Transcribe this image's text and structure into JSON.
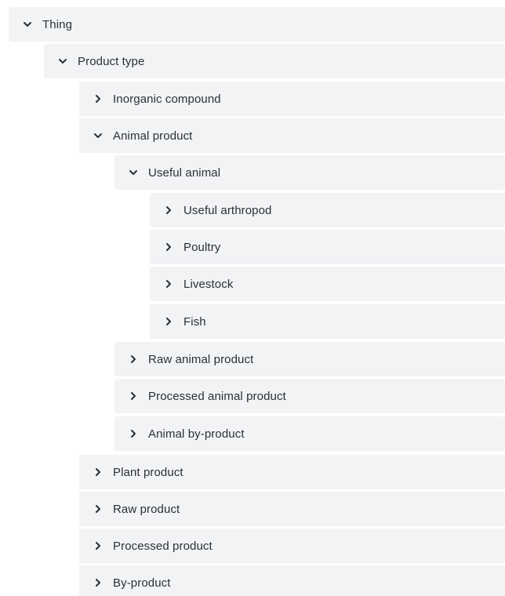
{
  "tree": {
    "nodes": [
      {
        "label": "Thing",
        "expanded": true,
        "icon": "chevron-down-icon"
      },
      {
        "label": "Product type",
        "expanded": true,
        "icon": "chevron-down-icon"
      },
      {
        "label": "Inorganic compound",
        "expanded": false,
        "icon": "chevron-right-icon"
      },
      {
        "label": "Animal product",
        "expanded": true,
        "icon": "chevron-down-icon"
      },
      {
        "label": "Useful animal",
        "expanded": true,
        "icon": "chevron-down-icon"
      },
      {
        "label": "Useful arthropod",
        "expanded": false,
        "icon": "chevron-right-icon"
      },
      {
        "label": "Poultry",
        "expanded": false,
        "icon": "chevron-right-icon"
      },
      {
        "label": "Livestock",
        "expanded": false,
        "icon": "chevron-right-icon"
      },
      {
        "label": "Fish",
        "expanded": false,
        "icon": "chevron-right-icon"
      },
      {
        "label": "Raw animal product",
        "expanded": false,
        "icon": "chevron-right-icon"
      },
      {
        "label": "Processed animal product",
        "expanded": false,
        "icon": "chevron-right-icon"
      },
      {
        "label": "Animal by-product",
        "expanded": false,
        "icon": "chevron-right-icon"
      },
      {
        "label": "Plant product",
        "expanded": false,
        "icon": "chevron-right-icon"
      },
      {
        "label": "Raw product",
        "expanded": false,
        "icon": "chevron-right-icon"
      },
      {
        "label": "Processed product",
        "expanded": false,
        "icon": "chevron-right-icon"
      },
      {
        "label": "By-product",
        "expanded": false,
        "icon": "chevron-right-icon"
      }
    ]
  }
}
